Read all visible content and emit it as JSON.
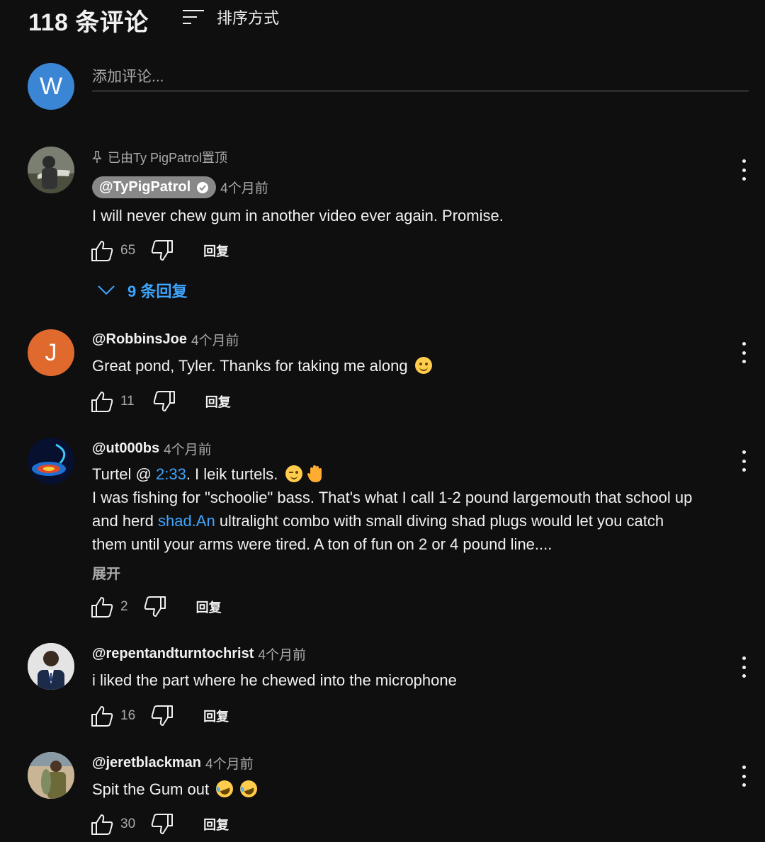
{
  "header": {
    "count_label": "118 条评论",
    "sort_label": "排序方式",
    "sort_icon": "sort-icon"
  },
  "add_comment": {
    "avatar_letter": "W",
    "avatar_color": "#3a86d4",
    "placeholder": "添加评论..."
  },
  "colors": {
    "background": "#0f0f0f",
    "link": "#3ea6ff",
    "secondary_text": "#aaaaaa"
  },
  "comments": [
    {
      "pinned_label": "已由Ty PigPatrol置顶",
      "author": "@TyPigPatrol",
      "verified": true,
      "time": "4个月前",
      "text": "I will never chew gum in another video ever again. Promise.",
      "likes": "65",
      "reply_label": "回复",
      "replies_label": "9 条回复"
    },
    {
      "avatar_letter": "J",
      "avatar_color": "#e0692e",
      "author": "@RobbinsJoe",
      "time": "4个月前",
      "text": "Great pond, Tyler.  Thanks for taking me along",
      "likes": "11",
      "reply_label": "回复"
    },
    {
      "author": "@ut000bs",
      "time": "4个月前",
      "text_l1_a": "Turtel @ ",
      "text_l1_link": "2:33",
      "text_l1_b": ". I leik turtels.",
      "text_l2": "I was fishing for \"schoolie\" bass. That's what I call 1-2 pound largemouth that school up",
      "text_l3_a": "and herd ",
      "text_l3_link": "shad.An",
      "text_l3_b": " ultralight combo with small diving shad plugs would let you catch",
      "text_l4": "them until your arms were tired. A ton of fun on 2 or 4 pound line....",
      "expand_label": "展开",
      "likes": "2",
      "reply_label": "回复"
    },
    {
      "author": "@repentandturntochrist",
      "time": "4个月前",
      "text": "i liked the part where he chewed into the microphone",
      "likes": "16",
      "reply_label": "回复"
    },
    {
      "author": "@jeretblackman",
      "time": "4个月前",
      "text": "Spit the Gum out",
      "likes": "30",
      "reply_label": "回复"
    }
  ]
}
